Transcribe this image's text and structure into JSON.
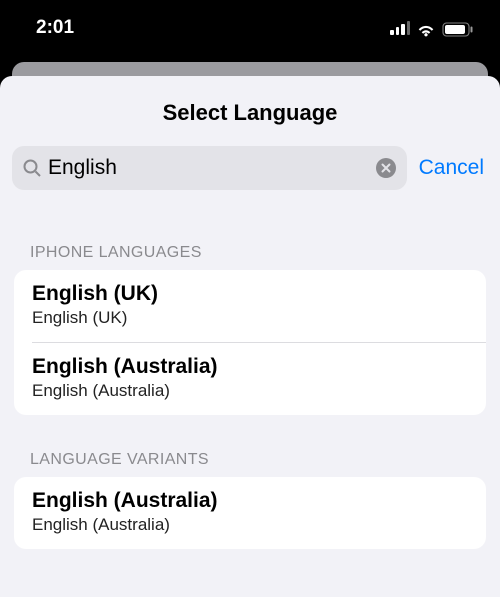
{
  "status": {
    "time": "2:01"
  },
  "sheet": {
    "title": "Select Language",
    "search_value": "English",
    "cancel_label": "Cancel"
  },
  "sections": {
    "iphone": {
      "header": "IPHONE LANGUAGES",
      "items": [
        {
          "primary": "English (UK)",
          "secondary": "English (UK)"
        },
        {
          "primary": "English (Australia)",
          "secondary": "English (Australia)"
        }
      ]
    },
    "variants": {
      "header": "LANGUAGE VARIANTS",
      "items": [
        {
          "primary": "English (Australia)",
          "secondary": "English (Australia)"
        }
      ]
    }
  }
}
